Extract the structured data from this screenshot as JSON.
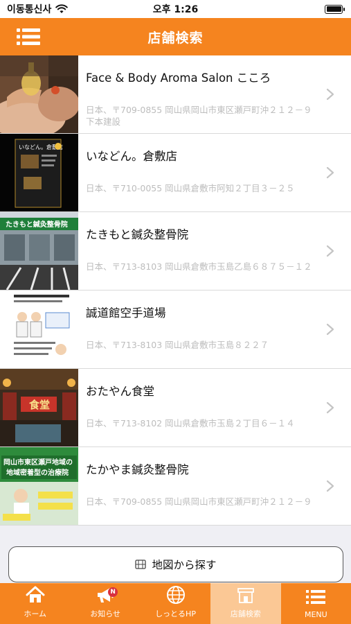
{
  "status_bar": {
    "carrier": "이동통신사",
    "time": "오후 1:26"
  },
  "header": {
    "title": "店舗検索"
  },
  "shops": [
    {
      "name": "Face & Body Aroma Salon こころ",
      "address": "日本、〒709-0855 岡山県岡山市東区瀬戸町沖２１２－９ 下本建設",
      "thumb_icon": "spa-massage-photo"
    },
    {
      "name": "いなどん。倉敷店",
      "address": "日本、〒710-0055 岡山県倉敷市阿知２丁目３－２５",
      "thumb_icon": "restaurant-menu-photo",
      "thumb_text": "いなどん。倉敷店"
    },
    {
      "name": "たきもと鍼灸整骨院",
      "address": "日本、〒713-8103 岡山県倉敷市玉島乙島６８７５－１２",
      "thumb_icon": "clinic-storefront-photo",
      "thumb_text": "たきもと鍼灸整骨院"
    },
    {
      "name": "誠道館空手道場",
      "address": "日本、〒713-8103 岡山県倉敷市玉島８２２７",
      "thumb_icon": "karate-flyer-photo"
    },
    {
      "name": "おたやん食堂",
      "address": "日本、〒713-8102 岡山県倉敷市玉島２丁目６－１４",
      "thumb_icon": "restaurant-storefront-photo",
      "thumb_text": "食堂"
    },
    {
      "name": "たかやま鍼灸整骨院",
      "address": "日本、〒709-0855 岡山県岡山市東区瀬戸町沖２１２－９",
      "thumb_icon": "clinic-poster-photo",
      "thumb_text": [
        "岡山市東区瀬戸地域の",
        "地域密着型の治療院"
      ]
    }
  ],
  "map_button": {
    "label": "地図から探す",
    "icon": "map-icon"
  },
  "tabs": [
    {
      "label": "ホーム",
      "icon": "home-icon"
    },
    {
      "label": "お知らせ",
      "icon": "megaphone-icon",
      "badge": "N"
    },
    {
      "label": "しっとるHP",
      "icon": "globe-icon"
    },
    {
      "label": "店舗検索",
      "icon": "store-icon",
      "active": true
    },
    {
      "label": "MENU",
      "icon": "menu-icon"
    }
  ],
  "colors": {
    "accent": "#f5841f",
    "active_tab": "#fbc895",
    "address_text": "#bdbdbd",
    "badge": "#d8303f"
  }
}
